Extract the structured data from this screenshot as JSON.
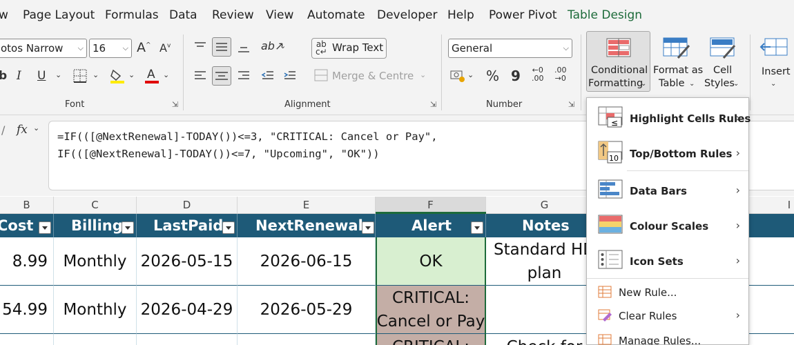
{
  "menu": {
    "tabs": [
      "w",
      "Page Layout",
      "Formulas",
      "Data",
      "Review",
      "View",
      "Automate",
      "Developer",
      "Help",
      "Power Pivot",
      "Table Design"
    ],
    "accent": "#1d6b3a"
  },
  "ribbon": {
    "font": {
      "name": "otos Narrow",
      "size": "16",
      "bold_partial": "b",
      "italic": "I",
      "underline": "U",
      "label": "Font"
    },
    "alignment": {
      "wrap_text": "Wrap Text",
      "merge_centre": "Merge & Centre",
      "label": "Alignment"
    },
    "number": {
      "format": "General",
      "percent": "%",
      "comma": "9",
      "label": "Number"
    },
    "styles": {
      "conditional_formatting": [
        "Conditional",
        "Formatting"
      ],
      "format_as_table": [
        "Format as",
        "Table"
      ],
      "cell_styles": [
        "Cell",
        "Styles"
      ]
    },
    "cells": {
      "insert": "Insert"
    }
  },
  "formula_bar": {
    "fx": "fx",
    "line1": "=IF(([@NextRenewal]-TODAY())<=3, \"CRITICAL: Cancel or Pay\",",
    "line2": "IF(([@NextRenewal]-TODAY())<=7, \"Upcoming\", \"OK\"))"
  },
  "columns": [
    "B",
    "C",
    "D",
    "E",
    "F",
    "G",
    "I"
  ],
  "table": {
    "headers": [
      "Cost",
      "Billing",
      "LastPaid",
      "NextRenewal",
      "Alert",
      "Notes"
    ],
    "rows": [
      {
        "cost": "8.99",
        "billing": "Monthly",
        "lastpaid": "2026-05-15",
        "nextrenewal": "2026-06-15",
        "alert": "OK",
        "notes": [
          "Standard HD",
          "plan"
        ]
      },
      {
        "cost": "54.99",
        "billing": "Monthly",
        "lastpaid": "2026-04-29",
        "nextrenewal": "2026-05-29",
        "alert": [
          "CRITICAL:",
          "Cancel or Pay"
        ],
        "notes": [
          "",
          ""
        ]
      },
      {
        "alert": [
          "CRITICAL:"
        ],
        "notes": [
          "Check for"
        ]
      }
    ],
    "colors": {
      "header": "#1e5a78",
      "ok": "#d8efd0",
      "critical": "#c4aea6"
    }
  },
  "cf_menu": {
    "items": [
      "Highlight Cells Rules",
      "Top/Bottom Rules",
      "Data Bars",
      "Colour Scales",
      "Icon Sets"
    ],
    "small_items": [
      "New Rule...",
      "Clear Rules",
      "Manage Rules..."
    ]
  }
}
